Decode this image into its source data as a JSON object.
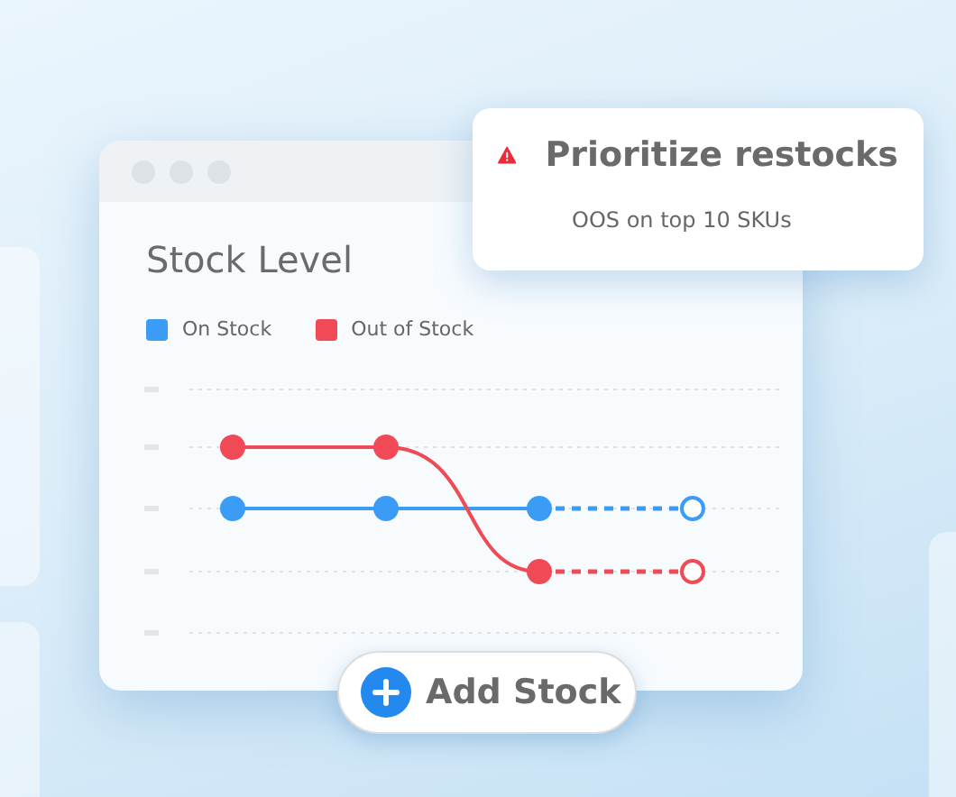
{
  "chart": {
    "title": "Stock Level",
    "legend": [
      {
        "label": "On Stock",
        "color": "#3a9cf5"
      },
      {
        "label": "Out of Stock",
        "color": "#ef4a55"
      }
    ]
  },
  "alert": {
    "title": "Prioritize restocks",
    "message": "OOS on top 10 SKUs"
  },
  "button": {
    "label": "Add Stock"
  }
}
